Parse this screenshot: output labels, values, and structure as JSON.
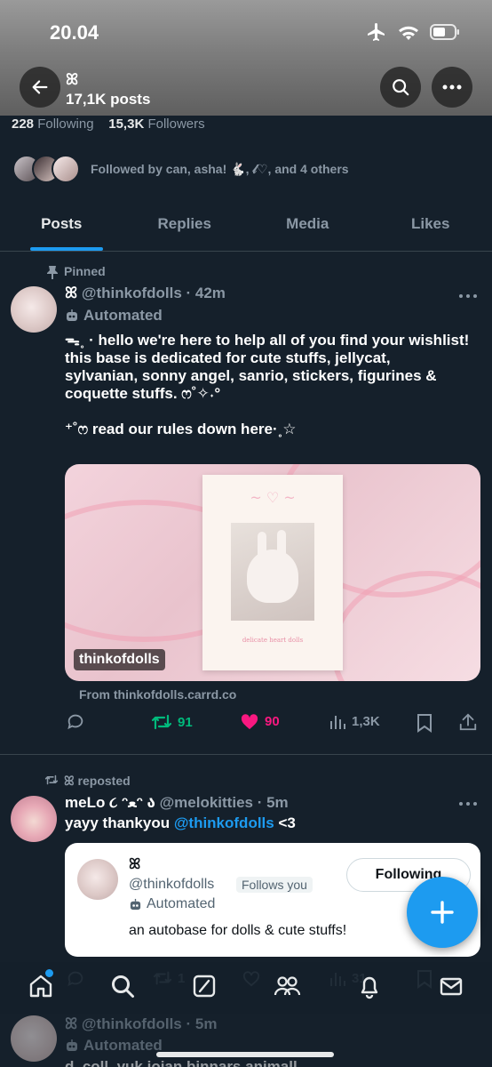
{
  "status_bar": {
    "time": "20.04",
    "icons": [
      "airplane-icon",
      "wifi-icon",
      "battery-icon"
    ]
  },
  "profile": {
    "name": "ꕤ",
    "posts_count": "17,1K posts",
    "following_count": "228",
    "following_label": "Following",
    "followers_count": "15,3K",
    "followers_label": "Followers",
    "followed_by": "Followed by can, asha! 🐇, 𝓁♡, and 4 others"
  },
  "tabs": [
    {
      "label": "Posts",
      "active": true
    },
    {
      "label": "Replies",
      "active": false
    },
    {
      "label": "Media",
      "active": false
    },
    {
      "label": "Likes",
      "active": false
    }
  ],
  "pinned_post": {
    "pinned_label": "Pinned",
    "author_name": "ꕤ",
    "handle_time": "@thinkofdolls · 42m",
    "automated_label": "Automated",
    "text_lines": [
      "ᯓ˳ · hello we're here to help all of you find your wishlist!",
      "this base is dedicated for cute stuffs, jellycat,",
      "sylvanian, sonny angel, sanrio, stickers, figurines &",
      "coquette stuffs. ෆ˚✧˖°",
      "",
      "⁺˚ෆ read our rules down here·˳☆"
    ],
    "card_tag": "thinkofdolls",
    "poster_caption": "delicate heart dolls",
    "link_source": "From thinkofdolls.carrd.co",
    "actions": {
      "retweets": "91",
      "likes": "90",
      "views": "1,3K"
    }
  },
  "repost": {
    "reposted_label": "ꕤ reposted",
    "author_name": "meLo ૮ ᵔﻌᵔ ა",
    "handle_time": "@melokitties · 5m",
    "text_prefix": "yayy thankyou ",
    "mention": "@thinkofdolls",
    "text_suffix": " <3",
    "quote": {
      "name": "ꕤ",
      "handle": "@thinkofdolls",
      "follows_you": "Follows you",
      "automated_label": "Automated",
      "bio": "an autobase for dolls & cute stuffs!",
      "following_button": "Following"
    },
    "actions": {
      "retweets": "1",
      "views": "31"
    }
  },
  "next_post": {
    "handle_time": "ꕤ @thinkofdolls · 5m",
    "automated_label": "Automated",
    "text_partial": "d_coll_yuk joian binnars animall"
  },
  "colors": {
    "background": "#15202b",
    "accent": "#1d9bf0",
    "retweet": "#00ba7c",
    "like": "#f91880"
  }
}
